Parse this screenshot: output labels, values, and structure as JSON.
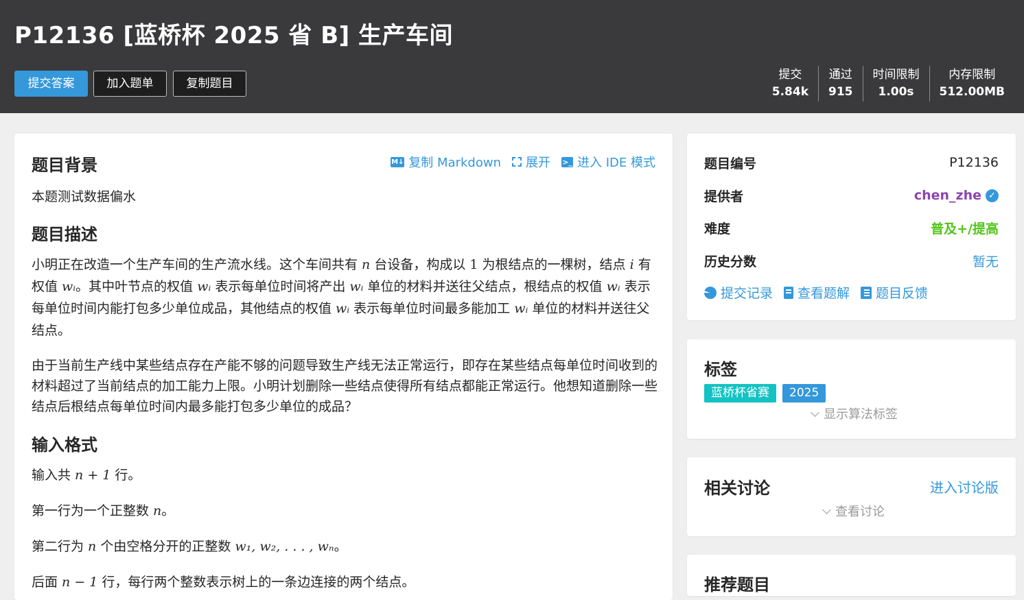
{
  "problem": {
    "title": "P12136 [蓝桥杯 2025 省 B] 生产车间",
    "buttons": {
      "submit": "提交答案",
      "add_list": "加入题单",
      "copy": "复制题目"
    },
    "stats": [
      {
        "label": "提交",
        "value": "5.84k"
      },
      {
        "label": "通过",
        "value": "915"
      },
      {
        "label": "时间限制",
        "value": "1.00s"
      },
      {
        "label": "内存限制",
        "value": "512.00MB"
      }
    ]
  },
  "main": {
    "actions": {
      "copy_md": "复制 Markdown",
      "expand": "展开",
      "ide": "进入 IDE 模式",
      "md_icon_text": "M↓",
      "ide_icon_text": ">_"
    },
    "background_title": "题目背景",
    "background_text": "本题测试数据偏水",
    "desc_title": "题目描述",
    "desc_p1": {
      "t1": "小明正在改造一个生产车间的生产流水线。这个车间共有 ",
      "m1": "n",
      "t2": " 台设备，构成以 ",
      "m2": "1",
      "t3": " 为根结点的一棵树，结点 ",
      "m3": "i",
      "t4": " 有权值 ",
      "m4": "wᵢ",
      "t5": "。其中叶节点的权值 ",
      "m5": "wᵢ",
      "t6": " 表示每单位时间将产出 ",
      "m6": "wᵢ",
      "t7": " 单位的材料并送往父结点，根结点的权值 ",
      "m7": "wᵢ",
      "t8": " 表示每单位时间内能打包多少单位成品，其他结点的权值 ",
      "m8": "wᵢ",
      "t9": " 表示每单位时间最多能加工 ",
      "m9": "wᵢ",
      "t10": " 单位的材料并送往父结点。"
    },
    "desc_p2": "由于当前生产线中某些结点存在产能不够的问题导致生产线无法正常运行，即存在某些结点每单位时间收到的材料超过了当前结点的加工能力上限。小明计划删除一些结点使得所有结点都能正常运行。他想知道删除一些结点后根结点每单位时间内最多能打包多少单位的成品？",
    "input_title": "输入格式",
    "input_lines": {
      "l1_a": "输入共 ",
      "l1_m": "n + 1",
      "l1_b": " 行。",
      "l2_a": "第一行为一个正整数 ",
      "l2_m": "n",
      "l2_b": "。",
      "l3_a": "第二行为 ",
      "l3_m1": "n",
      "l3_b": " 个由空格分开的正整数 ",
      "l3_m2": "w₁, w₂, . . . , wₙ",
      "l3_c": "。",
      "l4_a": "后面 ",
      "l4_m": "n − 1",
      "l4_b": " 行，每行两个整数表示树上的一条边连接的两个结点。"
    }
  },
  "sidebar": {
    "info": {
      "id_label": "题目编号",
      "id_value": "P12136",
      "provider_label": "提供者",
      "provider_value": "chen_zhe",
      "difficulty_label": "难度",
      "difficulty_value": "普及+/提高",
      "history_label": "历史分数",
      "history_value": "暂无",
      "links": {
        "records": "提交记录",
        "solutions": "查看题解",
        "feedback": "题目反馈"
      }
    },
    "tags": {
      "title": "标签",
      "items": [
        "蓝桥杯省赛",
        "2025"
      ],
      "show_algo": "显示算法标签"
    },
    "discussion": {
      "title": "相关讨论",
      "link": "进入讨论版",
      "toggle": "查看讨论"
    },
    "recommend": {
      "title": "推荐题目"
    }
  },
  "colors": {
    "accent": "#3498db",
    "header_bg": "#3a3a3c",
    "provider": "#8e44ad",
    "difficulty": "#52c41a",
    "tag_teal": "#13c2c2"
  }
}
